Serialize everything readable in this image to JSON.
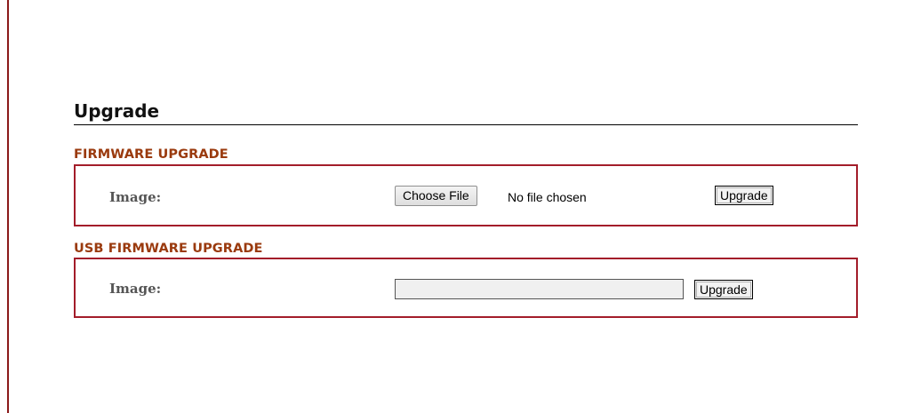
{
  "page": {
    "title": "Upgrade"
  },
  "firmware_upgrade": {
    "heading": "FIRMWARE UPGRADE",
    "image_label": "Image:",
    "choose_file_label": "Choose File",
    "file_status": "No file chosen",
    "upgrade_label": "Upgrade"
  },
  "usb_firmware_upgrade": {
    "heading": "USB FIRMWARE UPGRADE",
    "image_label": "Image:",
    "path_value": "",
    "upgrade_label": "Upgrade"
  },
  "colors": {
    "accent_rule": "#8b1a1a",
    "section_heading": "#9a3a0e",
    "box_border": "#a31d2a",
    "label_text": "#555555"
  }
}
